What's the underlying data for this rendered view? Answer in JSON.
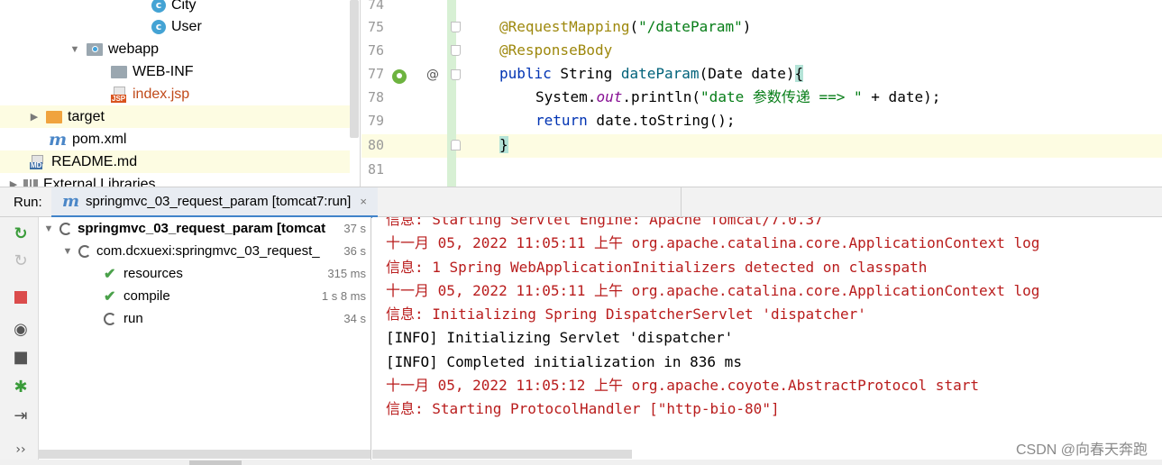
{
  "project_tree": {
    "items": [
      {
        "label": "City",
        "icon": "class-icon"
      },
      {
        "label": "User",
        "icon": "class-icon"
      },
      {
        "label": "webapp",
        "icon": "web-folder-icon",
        "expanded": true
      },
      {
        "label": "WEB-INF",
        "icon": "folder-icon"
      },
      {
        "label": "index.jsp",
        "icon": "jsp-file-icon",
        "color": "#c04a1a"
      },
      {
        "label": "target",
        "icon": "orange-folder-icon",
        "expanded": false
      },
      {
        "label": "pom.xml",
        "icon": "maven-icon"
      },
      {
        "label": "README.md",
        "icon": "markdown-file-icon"
      },
      {
        "label": "External Libraries",
        "icon": "library-icon"
      }
    ]
  },
  "editor": {
    "lines": [
      {
        "num": "74",
        "text": ""
      },
      {
        "num": "75",
        "annotation": "@RequestMapping",
        "paren_open": "(",
        "string": "\"/dateParam\"",
        "paren_close": ")"
      },
      {
        "num": "76",
        "annotation": "@ResponseBody"
      },
      {
        "num": "77",
        "kw": "public",
        "type": " String ",
        "method": "dateParam",
        "params": "(Date date)",
        "brace": "{"
      },
      {
        "num": "78",
        "prefix": "System.",
        "field": "out",
        "call": ".println(",
        "string": "\"date 参数传递 ==> \"",
        "rest": " + date);"
      },
      {
        "num": "79",
        "kw": "return",
        "rest": " date.toString();"
      },
      {
        "num": "80",
        "brace": "}"
      },
      {
        "num": "81",
        "text": ""
      }
    ]
  },
  "run_panel": {
    "label": "Run:",
    "tab_label": "springmvc_03_request_param [tomcat7:run]",
    "tab_close": "×",
    "toolbar": [
      "rerun-icon",
      "rerun-failed-icon",
      "stop-icon",
      "eye-icon",
      "camera-icon",
      "bug-icon",
      "exit-icon",
      "more-icon"
    ],
    "more_label": "››",
    "tree": [
      {
        "label": "springmvc_03_request_param [tomcat",
        "time": "37 s",
        "state": "running",
        "bold": true
      },
      {
        "label": "com.dcxuexi:springmvc_03_request_",
        "time": "36 s",
        "state": "running"
      },
      {
        "label": "resources",
        "time": "315 ms",
        "state": "done"
      },
      {
        "label": "compile",
        "time": "1 s 8 ms",
        "state": "done"
      },
      {
        "label": "run",
        "time": "34 s",
        "state": "running"
      }
    ]
  },
  "console": {
    "lines": [
      {
        "text": "信息: Starting Servlet Engine: Apache Tomcat/7.0.37",
        "color": "red"
      },
      {
        "text": "十一月 05, 2022 11:05:11 上午 org.apache.catalina.core.ApplicationContext log",
        "color": "red"
      },
      {
        "text": "信息: 1 Spring WebApplicationInitializers detected on classpath",
        "color": "red"
      },
      {
        "text": "十一月 05, 2022 11:05:11 上午 org.apache.catalina.core.ApplicationContext log",
        "color": "red"
      },
      {
        "text": "信息: Initializing Spring DispatcherServlet 'dispatcher'",
        "color": "red"
      },
      {
        "text": "[INFO] Initializing Servlet 'dispatcher'",
        "color": "black"
      },
      {
        "text": "[INFO] Completed initialization in 836 ms",
        "color": "black"
      },
      {
        "text": "十一月 05, 2022 11:05:12 上午 org.apache.coyote.AbstractProtocol start",
        "color": "red"
      },
      {
        "text": "信息: Starting ProtocolHandler [\"http-bio-80\"]",
        "color": "red"
      }
    ]
  },
  "watermark": "CSDN @向春天奔跑",
  "colors": {
    "accent": "#4083c9",
    "console_red": "#b91c1c",
    "highlight_row": "#fdfce2",
    "success": "#4aa14a",
    "stop": "#db4c4c"
  }
}
